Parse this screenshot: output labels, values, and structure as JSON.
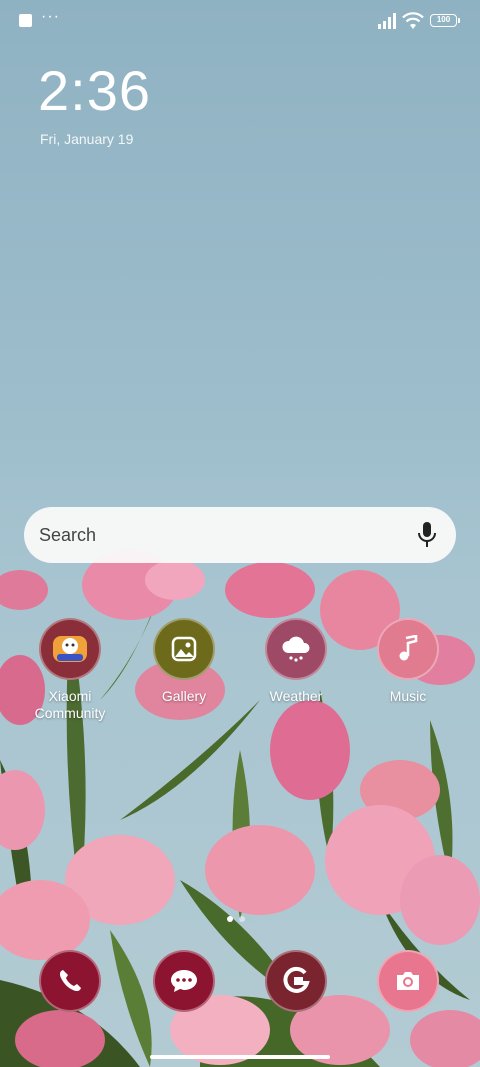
{
  "status_bar": {
    "notification_icon": "square-notification-icon",
    "more_indicator": "···",
    "battery_level": "100"
  },
  "lockscreen": {
    "time": "2:36",
    "date": "Fri, January 19"
  },
  "search": {
    "placeholder": "Search",
    "icon": "microphone-icon"
  },
  "apps": [
    {
      "label": "Xiaomi Community",
      "icon": "xiaomi-community-icon",
      "color": "#8a2e3a"
    },
    {
      "label": "Gallery",
      "icon": "gallery-icon",
      "color": "#6e6a1c"
    },
    {
      "label": "Weather",
      "icon": "weather-icon",
      "color": "#9e4a66"
    },
    {
      "label": "Music",
      "icon": "music-icon",
      "color": "#e07b90"
    }
  ],
  "dock": [
    {
      "icon": "phone-icon",
      "color": "#8d1430"
    },
    {
      "icon": "messages-icon",
      "color": "#8d1430"
    },
    {
      "icon": "browser-icon",
      "color": "#7a2430"
    },
    {
      "icon": "camera-icon",
      "color": "#e7768e"
    }
  ],
  "page_indicator": {
    "pages": 2,
    "current": 1
  }
}
